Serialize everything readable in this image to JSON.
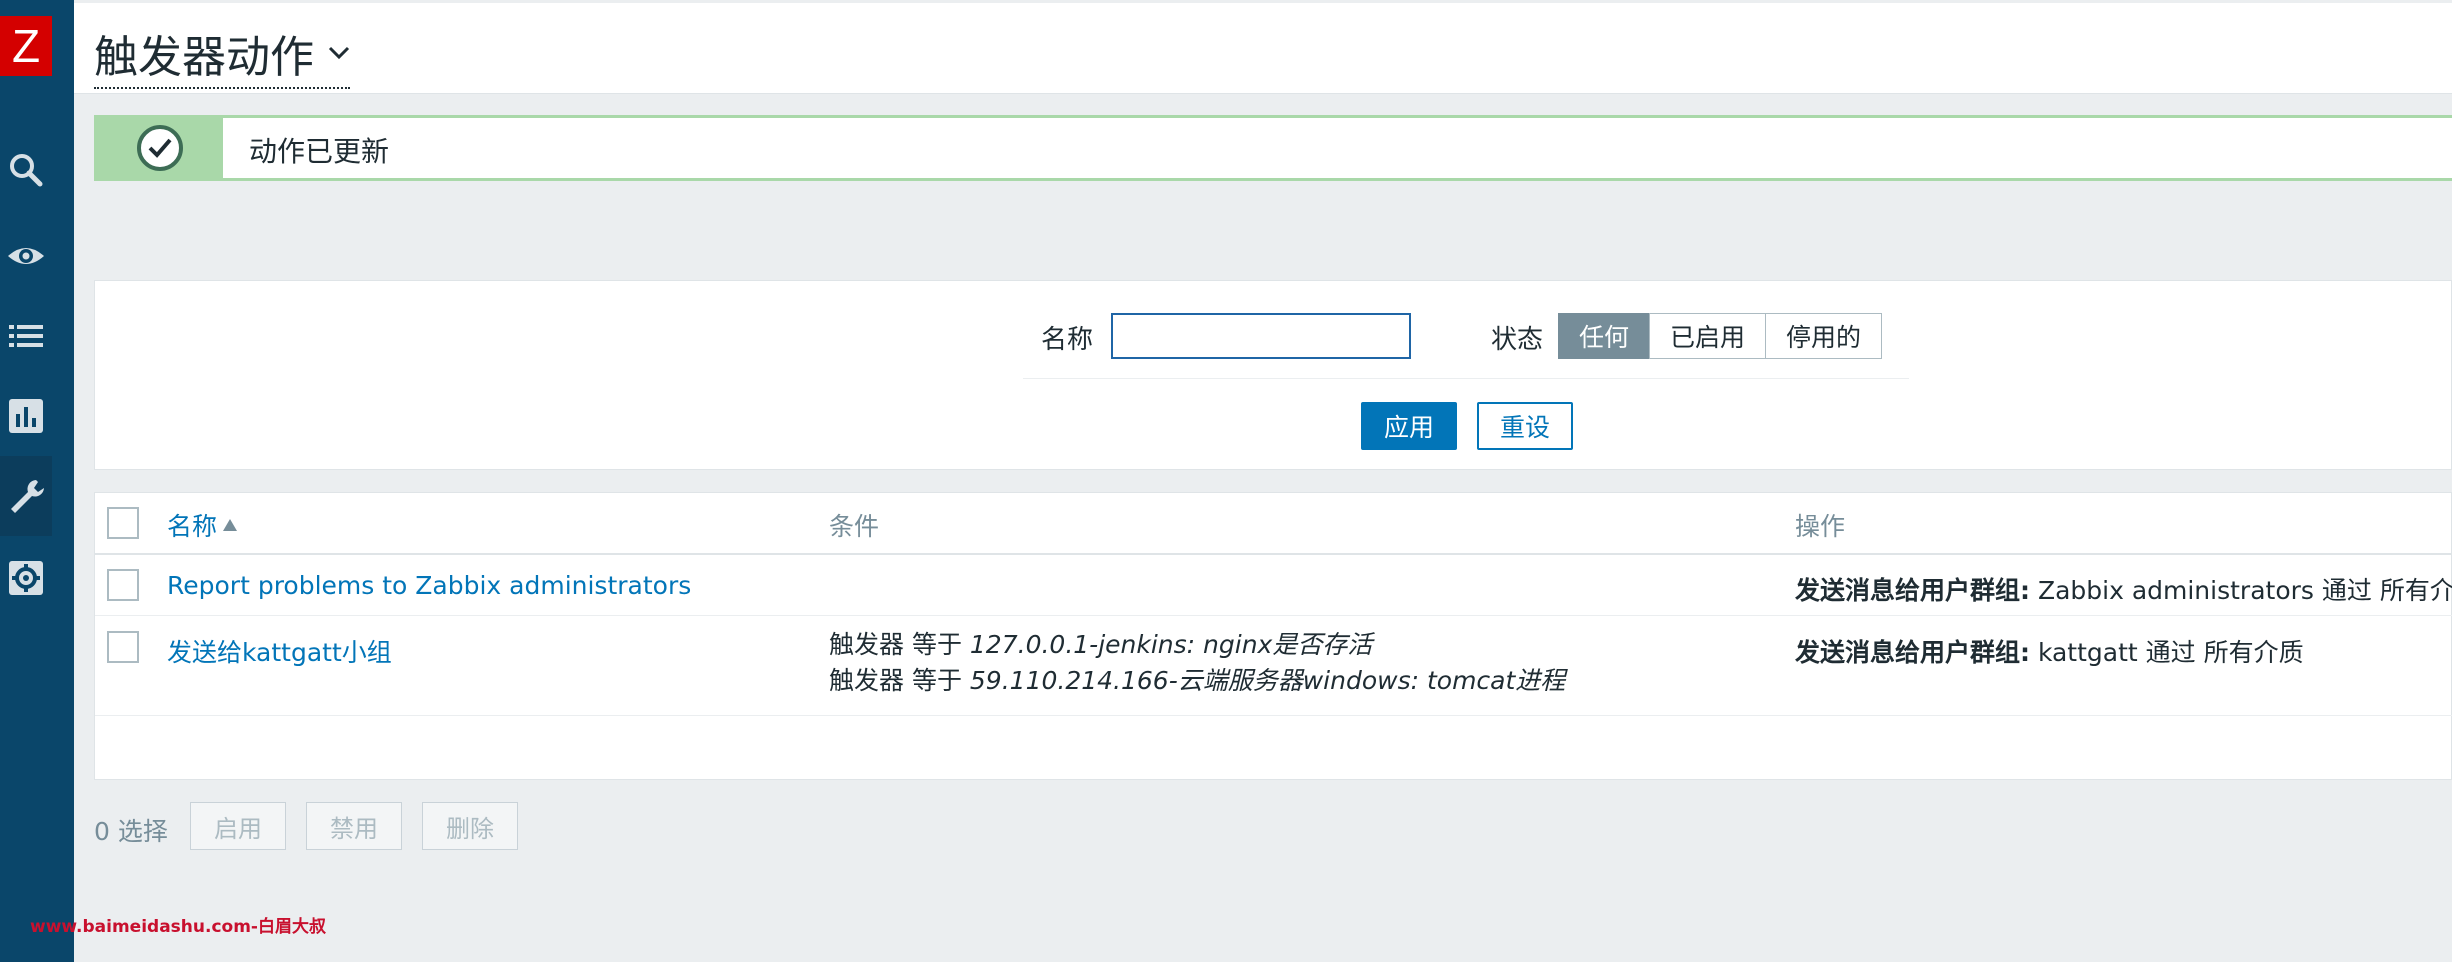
{
  "sidebar": {
    "logo": "Z",
    "icons": [
      "search-icon",
      "eye-icon",
      "list-icon",
      "chart-icon",
      "wrench-icon",
      "gear-icon"
    ]
  },
  "header": {
    "title": "触发器动作"
  },
  "message": {
    "text": "动作已更新",
    "color": "#a9d8a9"
  },
  "filter": {
    "name_label": "名称",
    "name_value": "",
    "status_label": "状态",
    "status_options": [
      "任何",
      "已启用",
      "停用的"
    ],
    "status_selected": "任何",
    "apply_label": "应用",
    "reset_label": "重设"
  },
  "table": {
    "columns": [
      "名称",
      "条件",
      "操作"
    ],
    "rows": [
      {
        "name": "Report problems to Zabbix administrators",
        "conditions": [],
        "op_bold": "发送消息给用户群组:",
        "op_text": " Zabbix administrators 通过 所有介质"
      },
      {
        "name": "发送给kattgatt小组",
        "conditions": [
          {
            "prefix": "触发器 等于 ",
            "value": "127.0.0.1-jenkins: nginx是否存活"
          },
          {
            "prefix": "触发器 等于 ",
            "value": "59.110.214.166-云端服务器windows: tomcat进程"
          }
        ],
        "op_bold": "发送消息给用户群组:",
        "op_text": " kattgatt 通过 所有介质"
      }
    ]
  },
  "footer": {
    "selected": "0 选择",
    "enable_label": "启用",
    "disable_label": "禁用",
    "delete_label": "删除"
  },
  "watermark": "www.baimeidashu.com-白眉大叔",
  "colors": {
    "sidebar": "#0a466a",
    "logo": "#d40000",
    "accent": "#0275b8"
  }
}
